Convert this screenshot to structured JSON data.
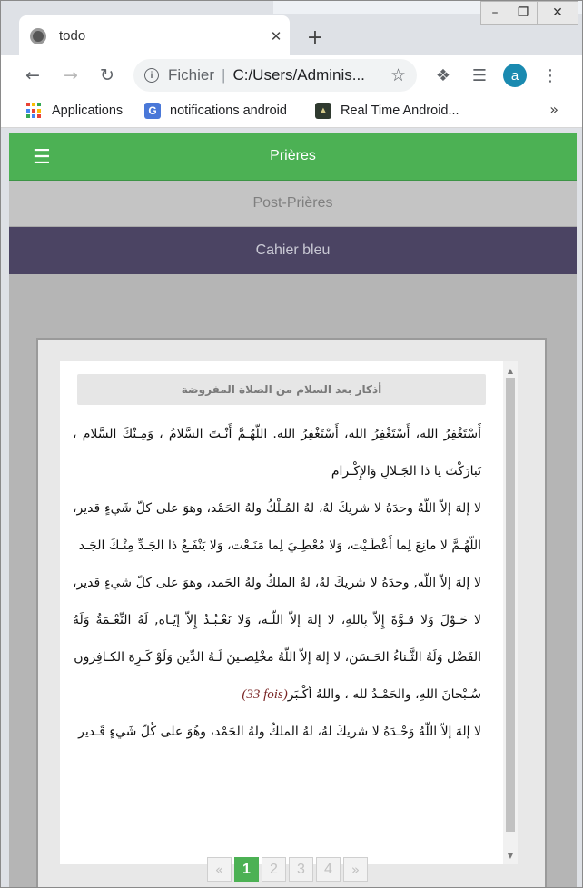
{
  "browser": {
    "tab": {
      "title": "todo"
    },
    "address": {
      "scheme_label": "Fichier",
      "url": "C:/Users/Adminis..."
    },
    "profile_initial": "a",
    "bookmarks": [
      {
        "label": "Applications",
        "icon": "apps-grid-icon"
      },
      {
        "label": "notifications android",
        "icon": "google-translate-icon"
      },
      {
        "label": "Real Time Android...",
        "icon": "android-icon"
      }
    ],
    "colors": {
      "chrome": "#dee1e6",
      "profile": "#1a8ab0"
    }
  },
  "app": {
    "menu": {
      "items": [
        {
          "label": "Prières"
        },
        {
          "label": "Post-Prières"
        },
        {
          "label": "Cahier bleu"
        }
      ]
    },
    "card": {
      "header": "أذكار بعد السلام من الصلاة المفروضة",
      "paragraphs": [
        "أَسْتَغْفِرُ الله، أَسْتَغْفِرُ الله، أَسْتَغْفِرُ الله. اللّهُـمَّ أَنْـتَ السَّلامُ ، وَمِـنْكَ السَّلام ، تَبارَكْتَ يا ذا الجَـلالِ وَالإِكْـرام",
        "لا إلهَ إلاّ اللّهُ وحدَهُ لا شريكَ لهُ، لهُ المُـلْكُ ولهُ الحَمْد، وهوَ على كلّ شَيءٍ قدير، اللّهُـمَّ لا مانِعَ لِما أَعْطَـيْت، وَلا مُعْطِـيَ لِما مَنَـعْت، وَلا يَنْفَـعُ ذا الجَـدِّ مِنْـكَ الجَـد",
        "لا إلهَ إلاّ اللّه, وحدَهُ لا شريكَ لهُ، لهُ الملكُ ولهُ الحَمد، وهوَ على كلّ شيءٍ قدير، لا حَـوْلَ وَلا قـوَّةَ إِلاّ بِاللهِ، لا إلهَ إلاّ اللّـه، وَلا نَعْـبُـدُ إِلاّ إيّـاه, لَهُ النِّعْـمَةُ وَلَهُ الفَضْل وَلَهُ الثَّـناءُ الحَـسَن، لا إلهَ إلاّ اللّهُ مخْلِصـينَ لَـهُ الدِّين وَلَوْ كَـرِهَ الكـافِرون",
        "سُـبْحانَ اللهِ، والحَمْـدُ لله ، واللهُ أكْـبَر",
        "لا إلهَ إلاّ اللّهُ وَحْـدَهُ لا شريكَ لهُ، لهُ الملكُ ولهُ الحَمْد، وهُوَ على كُلّ شَيءٍ قَـدير"
      ],
      "count_note": "(33 fois)"
    },
    "pagination": {
      "prev": "«",
      "pages": [
        "1",
        "2",
        "3",
        "4"
      ],
      "next": "»",
      "current": "1"
    },
    "colors": {
      "primary": "#4cb154",
      "dark": "#4b4463",
      "inactive": "#c4c4c4"
    }
  }
}
